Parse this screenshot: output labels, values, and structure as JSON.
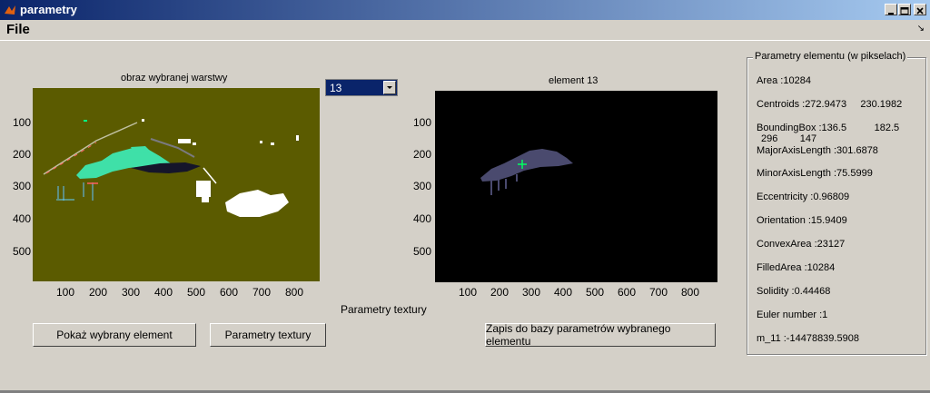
{
  "window": {
    "title": "parametry"
  },
  "menu": {
    "file": "File"
  },
  "plot1": {
    "title": "obraz wybranej warstwy",
    "yticks": [
      "100",
      "200",
      "300",
      "400",
      "500"
    ],
    "xticks": [
      "100",
      "200",
      "300",
      "400",
      "500",
      "600",
      "700",
      "800"
    ]
  },
  "plot2": {
    "title": "element  13",
    "yticks": [
      "100",
      "200",
      "300",
      "400",
      "500"
    ],
    "xticks": [
      "100",
      "200",
      "300",
      "400",
      "500",
      "600",
      "700",
      "800"
    ]
  },
  "colors": {
    "plot1_bg": "#5b5b00",
    "plot2_bg": "#000000",
    "element_fill": "#4a4a6e",
    "mint": "#3fe0a8",
    "titlebar": "#0a246a"
  },
  "selector": {
    "value": "13"
  },
  "texture_label": "Parametry textury",
  "buttons": {
    "show_element": "Pokaż wybrany element",
    "texture_params": "Parametry textury",
    "save": "Zapis do bazy parametrów wybranego elementu"
  },
  "panel": {
    "title": "Parametry elementu (w pikselach)",
    "params": [
      "Area :10284",
      "Centroids :272.9473     230.1982",
      "BoundingBox :136.5          182.5",
      "296        147",
      "MajorAxisLength :301.6878",
      "MinorAxisLength :75.5999",
      "Eccentricity :0.96809",
      "Orientation :15.9409",
      "ConvexArea :23127",
      "FilledArea :10284",
      "Solidity :0.44468",
      "Euler number :1",
      "m_11 :-14478839.5908"
    ]
  }
}
